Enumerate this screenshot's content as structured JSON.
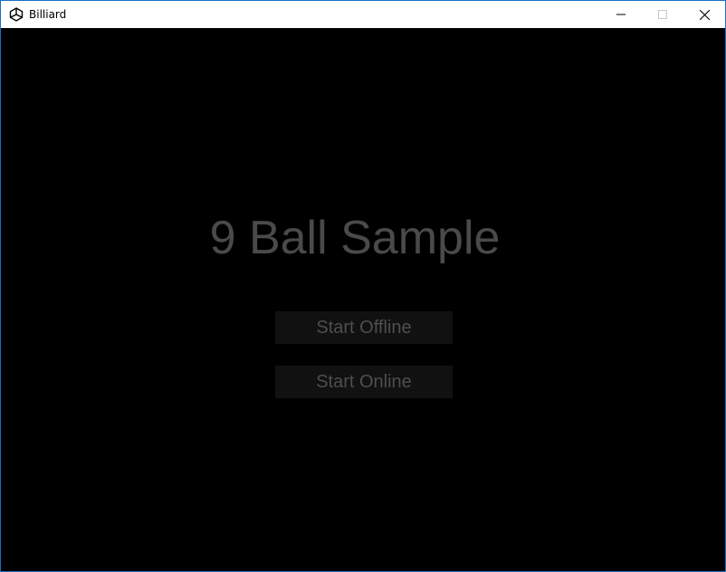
{
  "window": {
    "title": "Billiard",
    "icon": "unity-icon",
    "controls": {
      "minimize_icon": "minimize-icon",
      "maximize_icon": "maximize-icon",
      "close_icon": "close-icon"
    }
  },
  "game": {
    "title": "9 Ball Sample",
    "buttons": {
      "start_offline": "Start Offline",
      "start_online": "Start Online"
    }
  },
  "colors": {
    "background": "#000000",
    "title_text": "#4a4a4a",
    "button_bg": "#111111",
    "button_text": "#4e4e4e",
    "window_border": "#1b6fc4"
  }
}
